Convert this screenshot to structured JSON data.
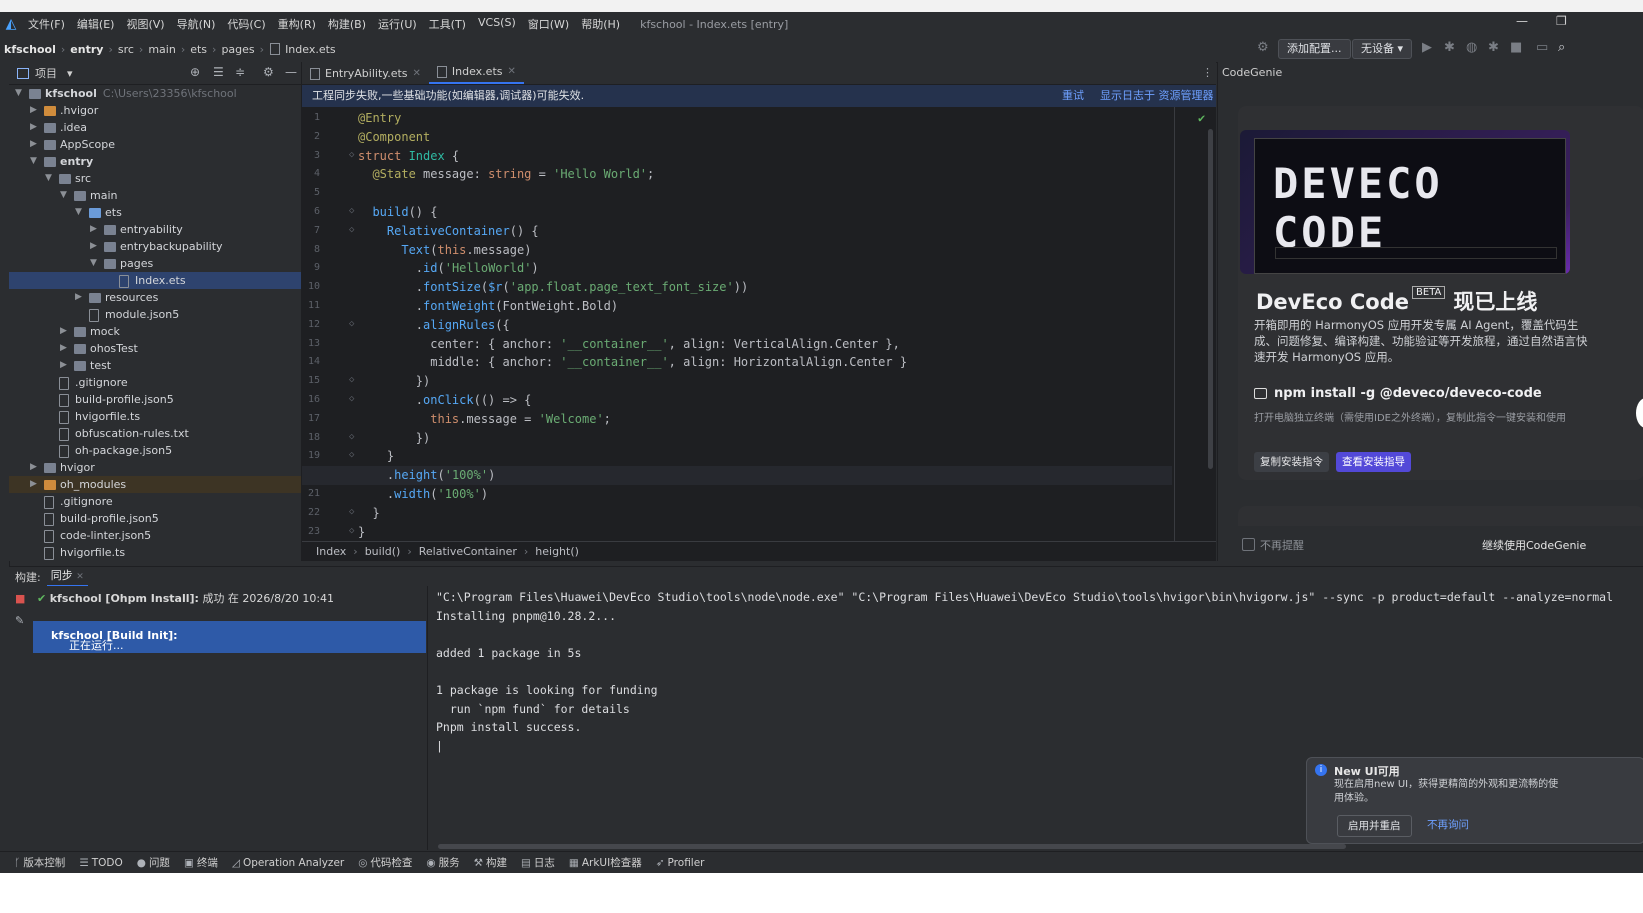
{
  "menu": [
    "文件(F)",
    "编辑(E)",
    "视图(V)",
    "导航(N)",
    "代码(C)",
    "重构(R)",
    "构建(B)",
    "运行(U)",
    "工具(T)",
    "VCS(S)",
    "窗口(W)",
    "帮助(H)"
  ],
  "window_title": "kfschool - Index.ets [entry]",
  "breadcrumbs": [
    "kfschool",
    "entry",
    "src",
    "main",
    "ets",
    "pages",
    "Index.ets"
  ],
  "toolbar": {
    "add_config": "添加配置...",
    "device": "无设备"
  },
  "project": {
    "header": "项目",
    "root_name": "kfschool",
    "root_path": "C:\\Users\\23356\\kfschool",
    "tree": [
      {
        "label": ".hvigor",
        "level": 1,
        "folder": true,
        "open": false,
        "style": "or"
      },
      {
        "label": ".idea",
        "level": 1,
        "folder": true,
        "open": false
      },
      {
        "label": "AppScope",
        "level": 1,
        "folder": true,
        "open": false
      },
      {
        "label": "entry",
        "level": 1,
        "folder": true,
        "open": true,
        "bold": true
      },
      {
        "label": "src",
        "level": 2,
        "folder": true,
        "open": true
      },
      {
        "label": "main",
        "level": 3,
        "folder": true,
        "open": true
      },
      {
        "label": "ets",
        "level": 4,
        "folder": true,
        "open": true,
        "style": "bl"
      },
      {
        "label": "entryability",
        "level": 5,
        "folder": true,
        "open": false
      },
      {
        "label": "entrybackupability",
        "level": 5,
        "folder": true,
        "open": false
      },
      {
        "label": "pages",
        "level": 5,
        "folder": true,
        "open": true
      },
      {
        "label": "Index.ets",
        "level": 6,
        "folder": false,
        "selected": true
      },
      {
        "label": "resources",
        "level": 4,
        "folder": true,
        "open": false
      },
      {
        "label": "module.json5",
        "level": 4,
        "folder": false
      },
      {
        "label": "mock",
        "level": 3,
        "folder": true,
        "open": false
      },
      {
        "label": "ohosTest",
        "level": 3,
        "folder": true,
        "open": false
      },
      {
        "label": "test",
        "level": 3,
        "folder": true,
        "open": false
      },
      {
        "label": ".gitignore",
        "level": 2,
        "folder": false
      },
      {
        "label": "build-profile.json5",
        "level": 2,
        "folder": false
      },
      {
        "label": "hvigorfile.ts",
        "level": 2,
        "folder": false
      },
      {
        "label": "obfuscation-rules.txt",
        "level": 2,
        "folder": false
      },
      {
        "label": "oh-package.json5",
        "level": 2,
        "folder": false
      },
      {
        "label": "hvigor",
        "level": 1,
        "folder": true,
        "open": false
      },
      {
        "label": "oh_modules",
        "level": 1,
        "folder": true,
        "open": false,
        "style": "or",
        "highlight": true
      },
      {
        "label": ".gitignore",
        "level": 1,
        "folder": false
      },
      {
        "label": "build-profile.json5",
        "level": 1,
        "folder": false
      },
      {
        "label": "code-linter.json5",
        "level": 1,
        "folder": false
      },
      {
        "label": "hvigorfile.ts",
        "level": 1,
        "folder": false
      }
    ]
  },
  "editor": {
    "tabs": [
      {
        "label": "EntryAbility.ets",
        "active": false
      },
      {
        "label": "Index.ets",
        "active": true
      }
    ],
    "banner": {
      "message": "工程同步失败,一些基础功能(如编辑器,调试器)可能失效.",
      "retry": "重试",
      "show_log": "显示日志于 资源管理器"
    },
    "current_line": 20,
    "lines": [
      [
        [
          "a",
          "@Entry"
        ]
      ],
      [
        [
          "a",
          "@Component"
        ]
      ],
      [
        [
          "k",
          "struct "
        ],
        [
          "t",
          "Index"
        ],
        [
          "p",
          " {"
        ]
      ],
      [
        [
          "p",
          "  "
        ],
        [
          "a",
          "@State "
        ],
        [
          "p",
          "message: "
        ],
        [
          "k",
          "string"
        ],
        [
          "p",
          " = "
        ],
        [
          "s",
          "'Hello World'"
        ],
        [
          "p",
          ";"
        ]
      ],
      [],
      [
        [
          "p",
          "  "
        ],
        [
          "f",
          "build"
        ],
        [
          "p",
          "() {"
        ]
      ],
      [
        [
          "p",
          "    "
        ],
        [
          "f",
          "RelativeContainer"
        ],
        [
          "p",
          "() {"
        ]
      ],
      [
        [
          "p",
          "      "
        ],
        [
          "f",
          "Text"
        ],
        [
          "p",
          "("
        ],
        [
          "k",
          "this"
        ],
        [
          "p",
          ".message)"
        ]
      ],
      [
        [
          "p",
          "        ."
        ],
        [
          "f",
          "id"
        ],
        [
          "p",
          "("
        ],
        [
          "s",
          "'HelloWorld'"
        ],
        [
          "p",
          ")"
        ]
      ],
      [
        [
          "p",
          "        ."
        ],
        [
          "f",
          "fontSize"
        ],
        [
          "p",
          "("
        ],
        [
          "f",
          "$r"
        ],
        [
          "p",
          "("
        ],
        [
          "s",
          "'app.float.page_text_font_size'"
        ],
        [
          "p",
          "))"
        ]
      ],
      [
        [
          "p",
          "        ."
        ],
        [
          "f",
          "fontWeight"
        ],
        [
          "p",
          "(FontWeight.Bold)"
        ]
      ],
      [
        [
          "p",
          "        ."
        ],
        [
          "f",
          "alignRules"
        ],
        [
          "p",
          "({"
        ]
      ],
      [
        [
          "p",
          "          center: { anchor: "
        ],
        [
          "s",
          "'__container__'"
        ],
        [
          "p",
          ", align: VerticalAlign.Center },"
        ]
      ],
      [
        [
          "p",
          "          middle: { anchor: "
        ],
        [
          "s",
          "'__container__'"
        ],
        [
          "p",
          ", align: HorizontalAlign.Center }"
        ]
      ],
      [
        [
          "p",
          "        })"
        ]
      ],
      [
        [
          "p",
          "        ."
        ],
        [
          "f",
          "onClick"
        ],
        [
          "p",
          "(() => {"
        ]
      ],
      [
        [
          "p",
          "          "
        ],
        [
          "k",
          "this"
        ],
        [
          "p",
          ".message = "
        ],
        [
          "s",
          "'Welcome'"
        ],
        [
          "p",
          ";"
        ]
      ],
      [
        [
          "p",
          "        })"
        ]
      ],
      [
        [
          "p",
          "    }"
        ]
      ],
      [
        [
          "p",
          "    ."
        ],
        [
          "f",
          "height"
        ],
        [
          "p",
          "("
        ],
        [
          "s",
          "'100%'"
        ],
        [
          "p",
          ")"
        ]
      ],
      [
        [
          "p",
          "    ."
        ],
        [
          "f",
          "width"
        ],
        [
          "p",
          "("
        ],
        [
          "s",
          "'100%'"
        ],
        [
          "p",
          ")"
        ]
      ],
      [
        [
          "p",
          "  }"
        ]
      ],
      [
        [
          "p",
          "}"
        ]
      ]
    ],
    "crumbs": [
      "Index",
      "build()",
      "RelativeContainer",
      "height()"
    ]
  },
  "codegenie": {
    "title": "CodeGenie",
    "image_logo": "DEVECO CODE",
    "head": "DevEco Code",
    "beta": "BETA",
    "head_suffix": "现已上线",
    "desc": "开箱即用的 HarmonyOS 应用开发专属 AI Agent，覆盖代码生成、问题修复、编译构建、功能验证等开发旅程，通过自然语言快速开发 HarmonyOS 应用。",
    "cmd": "npm install -g @deveco/deveco-code",
    "cmd_desc": "打开电脑独立终端（需使用IDE之外终端），复制此指令一键安装和使用",
    "copy_btn": "复制安装指令",
    "guide_btn": "查看安装指导",
    "no_remind": "不再提醒",
    "continue": "继续使用CodeGenie"
  },
  "build": {
    "label": "构建:",
    "tab": "同步",
    "item1_name": "kfschool [Ohpm Install]:",
    "item1_status": "成功 在 2026/8/20 10:41",
    "item2_name": "kfschool [Build Init]:",
    "item2_status": "正在运行...",
    "console": [
      "\"C:\\Program Files\\Huawei\\DevEco Studio\\tools\\node\\node.exe\" \"C:\\Program Files\\Huawei\\DevEco Studio\\tools\\hvigor\\bin\\hvigorw.js\" --sync -p product=default --analyze=normal",
      "Installing pnpm@10.28.2...",
      "",
      "added 1 package in 5s",
      "",
      "1 package is looking for funding",
      "  run `npm fund` for details",
      "Pnpm install success.",
      "|"
    ]
  },
  "notification": {
    "title": "New UI可用",
    "body": "现在启用new UI，获得更精简的外观和更流畅的使用体验。",
    "btn_enable": "启用并重启",
    "btn_never": "不再询问"
  },
  "statusbar": [
    {
      "icon": "branch-icon",
      "glyph": "ᚴ",
      "label": "版本控制"
    },
    {
      "icon": "todo-icon",
      "glyph": "☰",
      "label": "TODO"
    },
    {
      "icon": "problems-icon",
      "glyph": "●",
      "label": "问题"
    },
    {
      "icon": "terminal-icon",
      "glyph": "▣",
      "label": "终端"
    },
    {
      "icon": "analyzer-icon",
      "glyph": "◿",
      "label": "Operation Analyzer"
    },
    {
      "icon": "code-check-icon",
      "glyph": "◎",
      "label": "代码检查"
    },
    {
      "icon": "services-icon",
      "glyph": "◉",
      "label": "服务"
    },
    {
      "icon": "build-icon",
      "glyph": "⚒",
      "label": "构建"
    },
    {
      "icon": "log-icon",
      "glyph": "▤",
      "label": "日志"
    },
    {
      "icon": "arkui-inspector-icon",
      "glyph": "▦",
      "label": "ArkUI检查器"
    },
    {
      "icon": "profiler-icon",
      "glyph": "➶",
      "label": "Profiler"
    }
  ]
}
